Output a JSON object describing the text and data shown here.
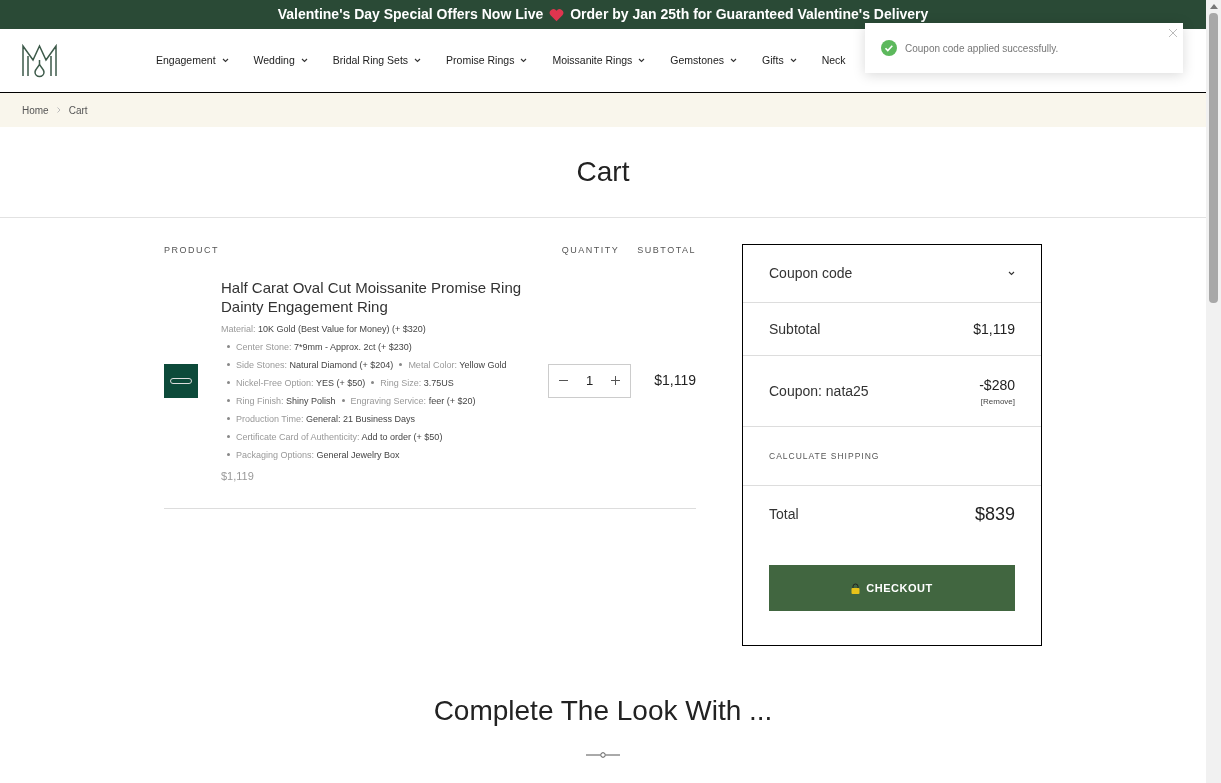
{
  "announcement": {
    "before": "Valentine's Day Special Offers Now Live",
    "after": "Order by Jan 25th for Guaranteed Valentine's Delivery"
  },
  "nav": [
    {
      "label": "Engagement",
      "dropdown": true
    },
    {
      "label": "Wedding",
      "dropdown": true
    },
    {
      "label": "Bridal Ring Sets",
      "dropdown": true
    },
    {
      "label": "Promise Rings",
      "dropdown": true
    },
    {
      "label": "Moissanite Rings",
      "dropdown": true
    },
    {
      "label": "Gemstones",
      "dropdown": true
    },
    {
      "label": "Gifts",
      "dropdown": true
    },
    {
      "label": "Neck",
      "dropdown": false
    }
  ],
  "toast": {
    "message": "Coupon code applied successfully."
  },
  "breadcrumb": [
    "Home",
    "Cart"
  ],
  "page_title": "Cart",
  "cart": {
    "columns": {
      "product": "PRODUCT",
      "quantity": "QUANTITY",
      "subtotal": "SUBTOTAL"
    },
    "items": [
      {
        "name": "Half Carat Oval Cut Moissanite Promise Ring Dainty Engagement Ring",
        "options": [
          {
            "label": "Material:",
            "value": "10K Gold (Best Value for Money) (+ $320)"
          },
          {
            "label": "Center Stone:",
            "value": "7*9mm - Approx. 2ct (+ $230)"
          },
          {
            "label": "Side Stones:",
            "value": "Natural Diamond (+ $204)"
          },
          {
            "label": "Metal Color:",
            "value": "Yellow Gold"
          },
          {
            "label": "Nickel-Free Option:",
            "value": "YES (+ $50)"
          },
          {
            "label": "Ring Size:",
            "value": "3.75US"
          },
          {
            "label": "Ring Finish:",
            "value": "Shiny Polish"
          },
          {
            "label": "Engraving Service:",
            "value": "feer (+ $20)"
          },
          {
            "label": "Production Time:",
            "value": "General: 21 Business Days"
          },
          {
            "label": "Certificate Card of Authenticity:",
            "value": "Add to order (+ $50)"
          },
          {
            "label": "Packaging Options:",
            "value": "General Jewelry Box"
          }
        ],
        "price": "$1,119",
        "quantity": "1",
        "subtotal": "$1,119"
      }
    ]
  },
  "summary": {
    "coupon_toggle": "Coupon code",
    "subtotal_label": "Subtotal",
    "subtotal": "$1,119",
    "coupon_label": "Coupon: nata25",
    "coupon_amount": "-$280",
    "remove": "[Remove]",
    "shipping": "CALCULATE SHIPPING",
    "total_label": "Total",
    "total": "$839",
    "checkout": "CHECKOUT"
  },
  "section_title": "Complete The Look With ..."
}
